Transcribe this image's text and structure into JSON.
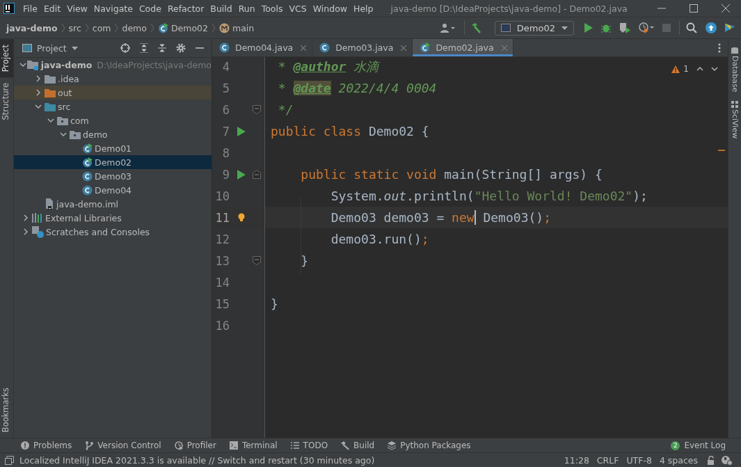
{
  "menu": [
    "File",
    "Edit",
    "View",
    "Navigate",
    "Code",
    "Refactor",
    "Build",
    "Run",
    "Tools",
    "VCS",
    "Window",
    "Help"
  ],
  "window": {
    "title": "java-demo [D:\\IdeaProjects\\java-demo] - Demo02.java"
  },
  "breadcrumbs": [
    {
      "label": "java-demo",
      "kind": "project"
    },
    {
      "label": "src",
      "kind": "dir"
    },
    {
      "label": "com",
      "kind": "dir"
    },
    {
      "label": "demo",
      "kind": "dir"
    },
    {
      "label": "Demo02",
      "kind": "class"
    },
    {
      "label": "main",
      "kind": "method"
    }
  ],
  "run_config": "Demo02",
  "left_stripe": [
    {
      "label": "Project",
      "selected": true
    },
    {
      "label": "Structure",
      "selected": false
    }
  ],
  "left_stripe_bottom": "Bookmarks",
  "right_stripe": [
    "Database",
    "SciView"
  ],
  "project_panel": {
    "title": "Project",
    "tree": [
      {
        "label": "java-demo",
        "kind": "module",
        "hint": "D:\\IdeaProjects\\java-demo",
        "expanded": true,
        "selected": false,
        "children": [
          {
            "label": ".idea",
            "kind": "folder",
            "expanded": false,
            "selected": false
          },
          {
            "label": "out",
            "kind": "excluded",
            "expanded": false,
            "selected": false
          },
          {
            "label": "src",
            "kind": "source",
            "expanded": true,
            "selected": false,
            "children": [
              {
                "label": "com",
                "kind": "package",
                "expanded": true,
                "selected": false,
                "children": [
                  {
                    "label": "demo",
                    "kind": "package",
                    "expanded": true,
                    "selected": false,
                    "children": [
                      {
                        "label": "Demo01",
                        "kind": "runnable",
                        "selected": false
                      },
                      {
                        "label": "Demo02",
                        "kind": "runnable",
                        "selected": true
                      },
                      {
                        "label": "Demo03",
                        "kind": "class",
                        "selected": false
                      },
                      {
                        "label": "Demo04",
                        "kind": "class",
                        "selected": false
                      }
                    ]
                  }
                ]
              }
            ]
          },
          {
            "label": "java-demo.iml",
            "kind": "file",
            "selected": false
          }
        ]
      },
      {
        "label": "External Libraries",
        "kind": "libraries",
        "expanded": false,
        "selected": false
      },
      {
        "label": "Scratches and Consoles",
        "kind": "scratches",
        "expanded": false,
        "selected": false
      }
    ]
  },
  "editor_tabs": [
    {
      "label": "Demo04.java",
      "kind": "class",
      "selected": false
    },
    {
      "label": "Demo03.java",
      "kind": "class",
      "selected": false
    },
    {
      "label": "Demo02.java",
      "kind": "runnable",
      "selected": true
    }
  ],
  "inspections": {
    "warnings": "1"
  },
  "code": [
    {
      "number": "4",
      "current": false,
      "tokens": [
        {
          "t": " * ",
          "kind": "comment"
        },
        {
          "t": "@author",
          "kind": "tag"
        },
        {
          "t": " 水滴",
          "kind": "comment"
        }
      ]
    },
    {
      "number": "5",
      "current": false,
      "tokens": [
        {
          "t": " * ",
          "kind": "comment"
        },
        {
          "t": "@date",
          "kind": "tagmark"
        },
        {
          "t": " 2022/4/4 0004",
          "kind": "comment"
        }
      ]
    },
    {
      "number": "6",
      "current": false,
      "fold": {
        "kind": "end"
      },
      "tokens": [
        {
          "t": " */",
          "kind": "comment"
        }
      ]
    },
    {
      "number": "7",
      "current": false,
      "gutter_icon": {
        "kind": "run"
      },
      "tokens": [
        {
          "t": "public class ",
          "kind": "keyword"
        },
        {
          "t": "Demo02 {",
          "kind": "plain"
        }
      ]
    },
    {
      "number": "8",
      "current": false
    },
    {
      "number": "9",
      "current": false,
      "gutter_icon": {
        "kind": "run"
      },
      "fold": {
        "kind": "start"
      },
      "tokens": [
        {
          "t": "    public static void ",
          "kind": "keyword"
        },
        {
          "t": "main(String[] args) {",
          "kind": "plain"
        }
      ]
    },
    {
      "number": "10",
      "current": false,
      "tokens": [
        {
          "t": "        System.",
          "kind": "plain"
        },
        {
          "t": "out",
          "kind": "field"
        },
        {
          "t": ".println(",
          "kind": "plain"
        },
        {
          "t": "\"Hello World! Demo02\"",
          "kind": "string"
        },
        {
          "t": ");",
          "kind": "plain"
        }
      ]
    },
    {
      "number": "11",
      "current": true,
      "gutter_icon": {
        "kind": "bulb"
      },
      "tokens": [
        {
          "t": "        Demo03 demo03 = ",
          "kind": "plain"
        },
        {
          "t": "new",
          "kind": "keyword",
          "caret": true
        },
        {
          "t": " Demo03()",
          "kind": "plain"
        },
        {
          "t": ";",
          "kind": "keyword"
        }
      ]
    },
    {
      "number": "12",
      "current": false,
      "tokens": [
        {
          "t": "        demo03.run()",
          "kind": "plain"
        },
        {
          "t": ";",
          "kind": "keyword"
        }
      ]
    },
    {
      "number": "13",
      "current": false,
      "fold": {
        "kind": "end"
      },
      "tokens": [
        {
          "t": "    }",
          "kind": "plain"
        }
      ]
    },
    {
      "number": "14",
      "current": false
    },
    {
      "number": "15",
      "current": false,
      "tokens": [
        {
          "t": "}",
          "kind": "plain"
        }
      ]
    },
    {
      "number": "16",
      "current": false
    }
  ],
  "tool_windows": [
    {
      "label": "Problems",
      "kind": "problems"
    },
    {
      "label": "Version Control",
      "kind": "vcs"
    },
    {
      "label": "Profiler",
      "kind": "profiler"
    },
    {
      "label": "Terminal",
      "kind": "terminal"
    },
    {
      "label": "TODO",
      "kind": "todo"
    },
    {
      "label": "Build",
      "kind": "build"
    },
    {
      "label": "Python Packages",
      "kind": "packages"
    }
  ],
  "event_log": {
    "label": "Event Log",
    "count": "2"
  },
  "status_bar": {
    "message": "Localized IntelliJ IDEA 2021.3.3 is available // Switch and restart (30 minutes ago)",
    "items": [
      "11:28",
      "CRLF",
      "UTF-8",
      "4 spaces"
    ]
  }
}
